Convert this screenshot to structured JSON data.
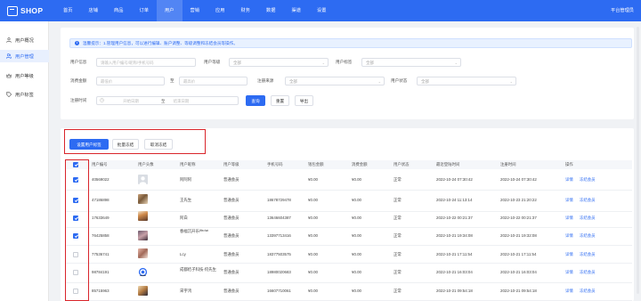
{
  "app": {
    "logo_text": "SHOP",
    "admin_label": "平台管理员"
  },
  "nav": [
    {
      "label": "首页",
      "active": false
    },
    {
      "label": "店铺",
      "active": false
    },
    {
      "label": "商品",
      "active": false
    },
    {
      "label": "订单",
      "active": false
    },
    {
      "label": "用户",
      "active": true
    },
    {
      "label": "营销",
      "active": false
    },
    {
      "label": "应用",
      "active": false
    },
    {
      "label": "财务",
      "active": false
    },
    {
      "label": "数据",
      "active": false
    },
    {
      "label": "渠道",
      "active": false
    },
    {
      "label": "设置",
      "active": false
    }
  ],
  "sidebar": [
    {
      "label": "用户概况",
      "icon": "person-icon",
      "active": false
    },
    {
      "label": "用户管理",
      "icon": "users-icon",
      "active": true
    },
    {
      "label": "用户等级",
      "icon": "level-icon",
      "active": false
    },
    {
      "label": "用户标签",
      "icon": "tag-icon",
      "active": false
    }
  ],
  "tip": {
    "text": "温馨提示：1.管理用户信息，可以进行编辑、账户调整、等级调整和冻结会员等操作。"
  },
  "filters": {
    "user_info_label": "用户信息",
    "user_info_placeholder": "请输入用户编号/昵称/手机号码",
    "user_level_label": "用户等级",
    "user_level_value": "全部",
    "user_tag_label": "用户标签",
    "user_tag_value": "全部",
    "spend_label": "消费金额",
    "spend_min_placeholder": "最低价",
    "range_sep": "至",
    "spend_max_placeholder": "最高价",
    "source_label": "注册来源",
    "source_value": "全部",
    "status_label": "用户状态",
    "status_value": "全部",
    "reg_time_label": "注册时间",
    "start_date_placeholder": "开始日期",
    "date_sep": "至",
    "end_date_placeholder": "结束日期",
    "query_button": "查询",
    "reset_button": "重置",
    "export_button": "导出"
  },
  "actions": {
    "set_tag_button": "设置用户标签",
    "batch_freeze_button": "批量冻结",
    "unfreeze_button": "取消冻结"
  },
  "table": {
    "headers": [
      "用户编号",
      "用户头像",
      "用户昵称",
      "用户等级",
      "手机号码",
      "钱包金额",
      "消费金额",
      "用户状态",
      "最近登陆时间",
      "注册时间",
      "操作"
    ],
    "action_detail": "详情",
    "action_freeze": "冻结会员",
    "rows": [
      {
        "id": "40569022",
        "nickname": "阿阿阿",
        "level": "普通会员",
        "phone": "",
        "wallet": "¥0.00",
        "spend": "¥0.00",
        "status": "正常",
        "last_login": "2022-10-24 07:30:42",
        "registered": "2022-10-24 07:30:42",
        "checked": true,
        "avatar": "placeholder"
      },
      {
        "id": "47186898",
        "nickname": "王先生",
        "level": "普通会员",
        "phone": "18678729478",
        "wallet": "¥0.00",
        "spend": "¥0.00",
        "status": "正常",
        "last_login": "2022-10-24 11:13:14",
        "registered": "2022-10-23 21:20:22",
        "checked": true,
        "avatar": "photo"
      },
      {
        "id": "17633649",
        "nickname": "阿白",
        "level": "普通会员",
        "phone": "13646604387",
        "wallet": "¥0.00",
        "spend": "¥0.00",
        "status": "正常",
        "last_login": "2022-10-22 00:21:37",
        "registered": "2022-10-22 00:21:37",
        "checked": true,
        "avatar": "photo"
      },
      {
        "id": "76425858",
        "nickname": "春福沉开乐ᵂᵉᶜʰᵃᵗ",
        "level": "普通会员",
        "phone": "13397713416",
        "wallet": "¥0.00",
        "spend": "¥0.00",
        "status": "正常",
        "last_login": "2022-10-21 19:34:08",
        "registered": "2022-10-21 19:32:08",
        "checked": true,
        "avatar": "photo"
      },
      {
        "id": "77536741",
        "nickname": "Lcy",
        "level": "普通会员",
        "phone": "18377503575",
        "wallet": "¥0.00",
        "spend": "¥0.00",
        "status": "正常",
        "last_login": "2022-10-21 17:11:54",
        "registered": "2022-10-21 17:11:54",
        "checked": false,
        "avatar": "photo"
      },
      {
        "id": "98784191",
        "nickname": "成都桔子科技-何先生",
        "level": "普通会员",
        "phone": "18980020683",
        "wallet": "¥0.00",
        "spend": "¥0.00",
        "status": "正常",
        "last_login": "2022-10-21 16:03:04",
        "registered": "2022-10-21 16:03:04",
        "checked": false,
        "avatar": "logo"
      },
      {
        "id": "85715963",
        "nickname": "宋宇鸿",
        "level": "普通会员",
        "phone": "16607710061",
        "wallet": "¥0.00",
        "spend": "¥0.00",
        "status": "正常",
        "last_login": "2022-10-21 09:54:18",
        "registered": "2022-10-21 09:54:18",
        "checked": false,
        "avatar": "photo"
      }
    ]
  },
  "colors": {
    "primary": "#2d6bf2",
    "highlight": "#d9252b"
  }
}
